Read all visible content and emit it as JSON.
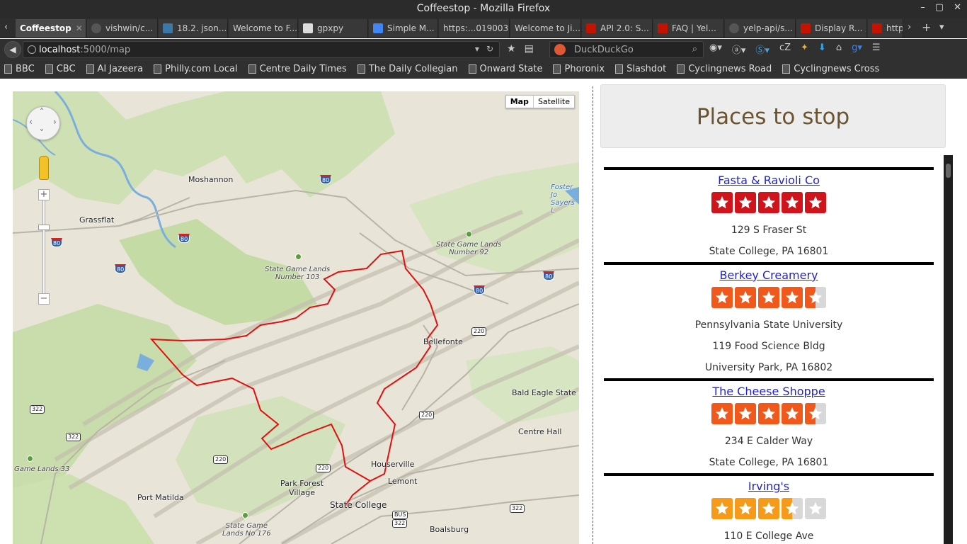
{
  "window": {
    "title": "Coffeestop - Mozilla Firefox"
  },
  "tabs": [
    {
      "label": "Coffeestop",
      "active": true
    },
    {
      "label": "vishwin/c..."
    },
    {
      "label": "18.2. json..."
    },
    {
      "label": "Welcome to F..."
    },
    {
      "label": "gpxpy"
    },
    {
      "label": "Simple M..."
    },
    {
      "label": "https:...019003"
    },
    {
      "label": "Welcome to Ji..."
    },
    {
      "label": "API 2.0: S..."
    },
    {
      "label": "FAQ | Yel..."
    },
    {
      "label": "yelp-api/s..."
    },
    {
      "label": "Display R..."
    },
    {
      "label": "http"
    }
  ],
  "urlbar": {
    "host": "localhost",
    "path": ":5000/map"
  },
  "search": {
    "placeholder": "DuckDuckGo"
  },
  "bookmarks": [
    "BBC",
    "CBC",
    "Al Jazeera",
    "Philly.com Local",
    "Centre Daily Times",
    "The Daily Collegian",
    "Onward State",
    "Phoronix",
    "Slashdot",
    "Cyclingnews Road",
    "Cyclingnews Cross"
  ],
  "map": {
    "type_buttons": {
      "map": "Map",
      "satellite": "Satellite"
    },
    "labels": {
      "moshannon": "Moshannon",
      "grassflat": "Grassflat",
      "sgl103": "State Game Lands\nNumber 103",
      "sgl92": "State Game Lands\nNumber 92",
      "bellefonte": "Bellefonte",
      "bald_eagle": "Bald Eagle State Fo",
      "centre_hall": "Centre Hall",
      "houserville": "Houserville",
      "lemont": "Lemont",
      "park_forest": "Park Forest\nVillage",
      "port_matilda": "Port Matilda",
      "state_college": "State College",
      "boalsburg": "Boalsburg",
      "game_lands_33": "Game Lands 33",
      "sgl176": "State Game\nLands No 176",
      "foster": "Foster Jo\nSayers L"
    },
    "shields": {
      "i80": "80",
      "us220": "220",
      "us322": "322",
      "bus": "BUS"
    },
    "colors": {
      "route": "#e01010",
      "forest": "#c5dba5",
      "water": "#7aaedc"
    }
  },
  "panel": {
    "title": "Places to stop"
  },
  "places": [
    {
      "name": "Fasta & Ravioli Co",
      "rating": 5,
      "address": [
        "129 S Fraser St",
        "State College, PA 16801"
      ],
      "star_color": "#d0141b"
    },
    {
      "name": "Berkey Creamery",
      "rating": 4.5,
      "address": [
        "Pennsylvania State University",
        "119 Food Science Bldg",
        "University Park, PA 16802"
      ],
      "star_color": "#f0581c"
    },
    {
      "name": "The Cheese Shoppe",
      "rating": 4.5,
      "address": [
        "234 E Calder Way",
        "State College, PA 16801"
      ],
      "star_color": "#f0581c"
    },
    {
      "name": "Irving's",
      "rating": 3.5,
      "address": [
        "110 E College Ave"
      ],
      "star_color": "#f59a1a"
    }
  ]
}
